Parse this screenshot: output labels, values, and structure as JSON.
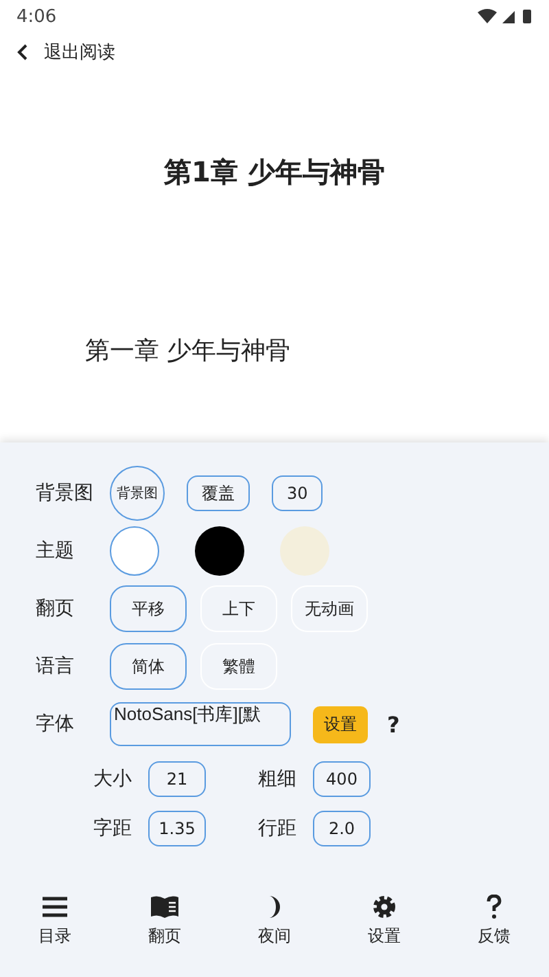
{
  "status_bar": {
    "time": "4:06"
  },
  "top_bar": {
    "back_label": "退出阅读"
  },
  "content": {
    "chapter_title": "第1章 少年与神骨",
    "heading": "第一章 少年与神骨"
  },
  "settings": {
    "background": {
      "label": "背景图",
      "options": [
        "背景图",
        "覆盖",
        "30"
      ]
    },
    "theme": {
      "label": "主题",
      "options": [
        {
          "color": "#ffffff",
          "selected": true
        },
        {
          "color": "#000000",
          "selected": false
        },
        {
          "color": "#f4efdc",
          "selected": false
        }
      ]
    },
    "page_turn": {
      "label": "翻页",
      "options": [
        {
          "label": "平移",
          "selected": true
        },
        {
          "label": "上下",
          "selected": false
        },
        {
          "label": "无动画",
          "selected": false
        }
      ]
    },
    "language": {
      "label": "语言",
      "options": [
        {
          "label": "简体",
          "selected": true
        },
        {
          "label": "繁體",
          "selected": false
        }
      ]
    },
    "font": {
      "label": "字体",
      "value": "NotoSans[书库][默",
      "set_button": "设置",
      "help": "?"
    },
    "metrics": [
      {
        "label": "大小",
        "value": "21"
      },
      {
        "label": "粗细",
        "value": "400"
      },
      {
        "label": "字距",
        "value": "1.35"
      },
      {
        "label": "行距",
        "value": "2.0"
      }
    ]
  },
  "bottom_nav": [
    {
      "kind": "menu",
      "label": "目录"
    },
    {
      "kind": "book",
      "label": "翻页"
    },
    {
      "kind": "moon",
      "label": "夜间"
    },
    {
      "kind": "gear",
      "label": "设置"
    },
    {
      "kind": "help",
      "label": "反馈"
    }
  ]
}
